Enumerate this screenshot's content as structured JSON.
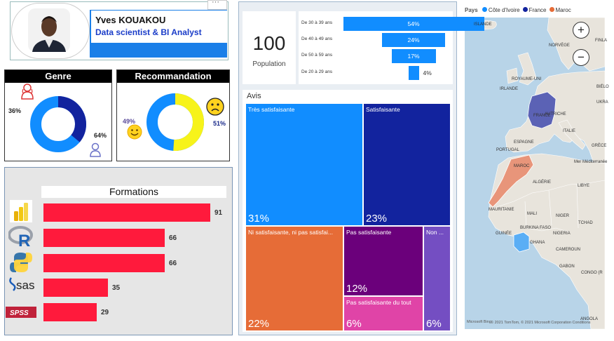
{
  "colors": {
    "dark_blue": "#12239E",
    "light_blue": "#118DFF",
    "yellow": "#F7F31A",
    "red": "#FF1A3C",
    "orange": "#E66C37",
    "purple": "#6B007B",
    "pink": "#E044A7",
    "violet": "#744EC2",
    "sea": "#B8D4E8",
    "land": "#E8E4DC"
  },
  "profile": {
    "name": "Yves KOUAKOU",
    "title": "Data scientist & BI Analyst",
    "more_icon": "ellipsis-icon"
  },
  "genre": {
    "title": "Genre",
    "pct_left": "36%",
    "pct_right": "64%",
    "value_left": 36,
    "value_right": 64,
    "icon_top": "female-user-icon",
    "icon_bottom": "male-user-icon"
  },
  "recommandation": {
    "title": "Recommandation",
    "pct_left": "49%",
    "pct_right": "51%",
    "value_left": 49,
    "value_right": 51,
    "icon_left": "smiley-happy-icon",
    "icon_right": "smiley-sad-icon"
  },
  "formations": {
    "title": "Formations",
    "items": [
      {
        "tool": "Power BI",
        "icon": "powerbi-icon",
        "value": 91,
        "label": "91"
      },
      {
        "tool": "R",
        "icon": "r-icon",
        "value": 66,
        "label": "66"
      },
      {
        "tool": "Python",
        "icon": "python-icon",
        "value": 66,
        "label": "66"
      },
      {
        "tool": "SAS",
        "icon": "sas-icon",
        "logo_text": "sas",
        "value": 35,
        "label": "35"
      },
      {
        "tool": "SPSS",
        "icon": "spss-icon",
        "logo_text": "SPSS",
        "value": 29,
        "label": "29"
      }
    ]
  },
  "population": {
    "value": "100",
    "label": "Population"
  },
  "ages": [
    {
      "label": "De 30 à 39 ans",
      "value": 54,
      "pct": "54%"
    },
    {
      "label": "De 40 à 49 ans",
      "value": 24,
      "pct": "24%"
    },
    {
      "label": "De 50 à 59 ans",
      "value": 17,
      "pct": "17%"
    },
    {
      "label": "De 20 à 29 ans",
      "value": 4,
      "pct": "4%"
    }
  ],
  "avis": {
    "title": "Avis",
    "items": [
      {
        "label": "Très satisfaisante",
        "pct": "31%",
        "value": 31
      },
      {
        "label": "Satisfaisante",
        "pct": "23%",
        "value": 23
      },
      {
        "label": "Ni satisfaisante, ni pas satisfai...",
        "pct": "22%",
        "value": 22
      },
      {
        "label": "Pas satisfaisante",
        "pct": "12%",
        "value": 12
      },
      {
        "label": "Non ...",
        "pct": "6%",
        "value": 6
      },
      {
        "label": "Pas satisfaisante du tout",
        "pct": "6%",
        "value": 6
      }
    ]
  },
  "map": {
    "legend_title": "Pays",
    "legend": [
      {
        "name": "Côte d'Ivoire",
        "color": "#118DFF"
      },
      {
        "name": "France",
        "color": "#12239E"
      },
      {
        "name": "Maroc",
        "color": "#E66C37"
      }
    ],
    "zoom_in": "+",
    "zoom_out": "−",
    "labels": [
      "ISLANDE",
      "NORVÈGE",
      "FINLA",
      "ROYAUME-UNI",
      "IRLANDE",
      "BIÉLO",
      "UKRA",
      "FRANCE",
      "AUTRICHE",
      "ITALIE",
      "ESPAGNE",
      "PORTUGAL",
      "GRÈCE",
      "Mer Méditerranée",
      "MAROC",
      "ALGÉRIE",
      "LIBYE",
      "MAURITANIE",
      "MALI",
      "NIGER",
      "TCHAD",
      "BURKINA FASO",
      "NIGERIA",
      "GHANA",
      "GUINÉE",
      "CAMEROUN",
      "GABON",
      "CONGO (R",
      "ANGOLA"
    ],
    "attribution": "© 2021 TomTom, © 2021 Microsoft Corporation Conditions",
    "brand": "Microsoft Bing"
  }
}
